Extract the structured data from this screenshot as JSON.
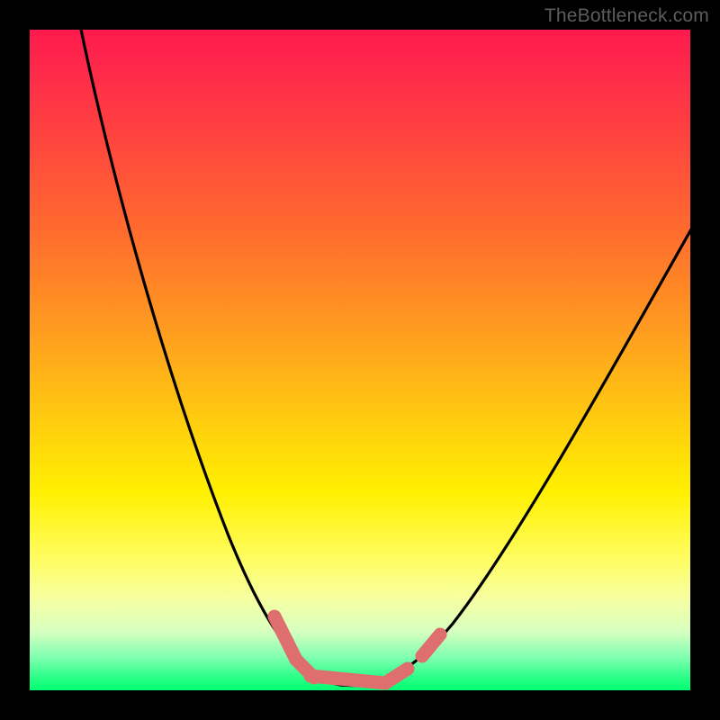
{
  "watermark": "TheBottleneck.com",
  "chart_data": {
    "type": "line",
    "title": "",
    "xlabel": "",
    "ylabel": "",
    "xlim": [
      0,
      100
    ],
    "ylim": [
      0,
      100
    ],
    "series": [
      {
        "name": "bottleneck-curve",
        "x": [
          7,
          10,
          13,
          16,
          19,
          22,
          25,
          28,
          31,
          33,
          35,
          37,
          39,
          41,
          43,
          45,
          48,
          52,
          56,
          60,
          64,
          68,
          72,
          76,
          80,
          84,
          88,
          92,
          96,
          100
        ],
        "values": [
          100,
          88,
          77,
          67,
          57,
          48,
          40,
          32,
          25,
          19,
          14,
          10,
          7,
          4,
          2,
          1,
          0,
          0,
          1,
          3,
          6,
          11,
          17,
          24,
          32,
          40,
          49,
          58,
          67,
          76
        ]
      }
    ],
    "annotations": {
      "optimal_segments": [
        {
          "x1": 37,
          "y1": 10,
          "x2": 40,
          "y2": 5
        },
        {
          "x1": 40,
          "y1": 5,
          "x2": 43,
          "y2": 2
        },
        {
          "x1": 43,
          "y1": 2,
          "x2": 50,
          "y2": 0.5
        },
        {
          "x1": 50,
          "y1": 0.5,
          "x2": 55,
          "y2": 1.5
        },
        {
          "x1": 57,
          "y1": 3,
          "x2": 60,
          "y2": 5
        }
      ]
    },
    "colors": {
      "curve": "#000000",
      "optimal_marker": "#e17070",
      "gradient_top": "#ff1a4d",
      "gradient_mid": "#fff000",
      "gradient_bottom": "#00ff70"
    }
  }
}
